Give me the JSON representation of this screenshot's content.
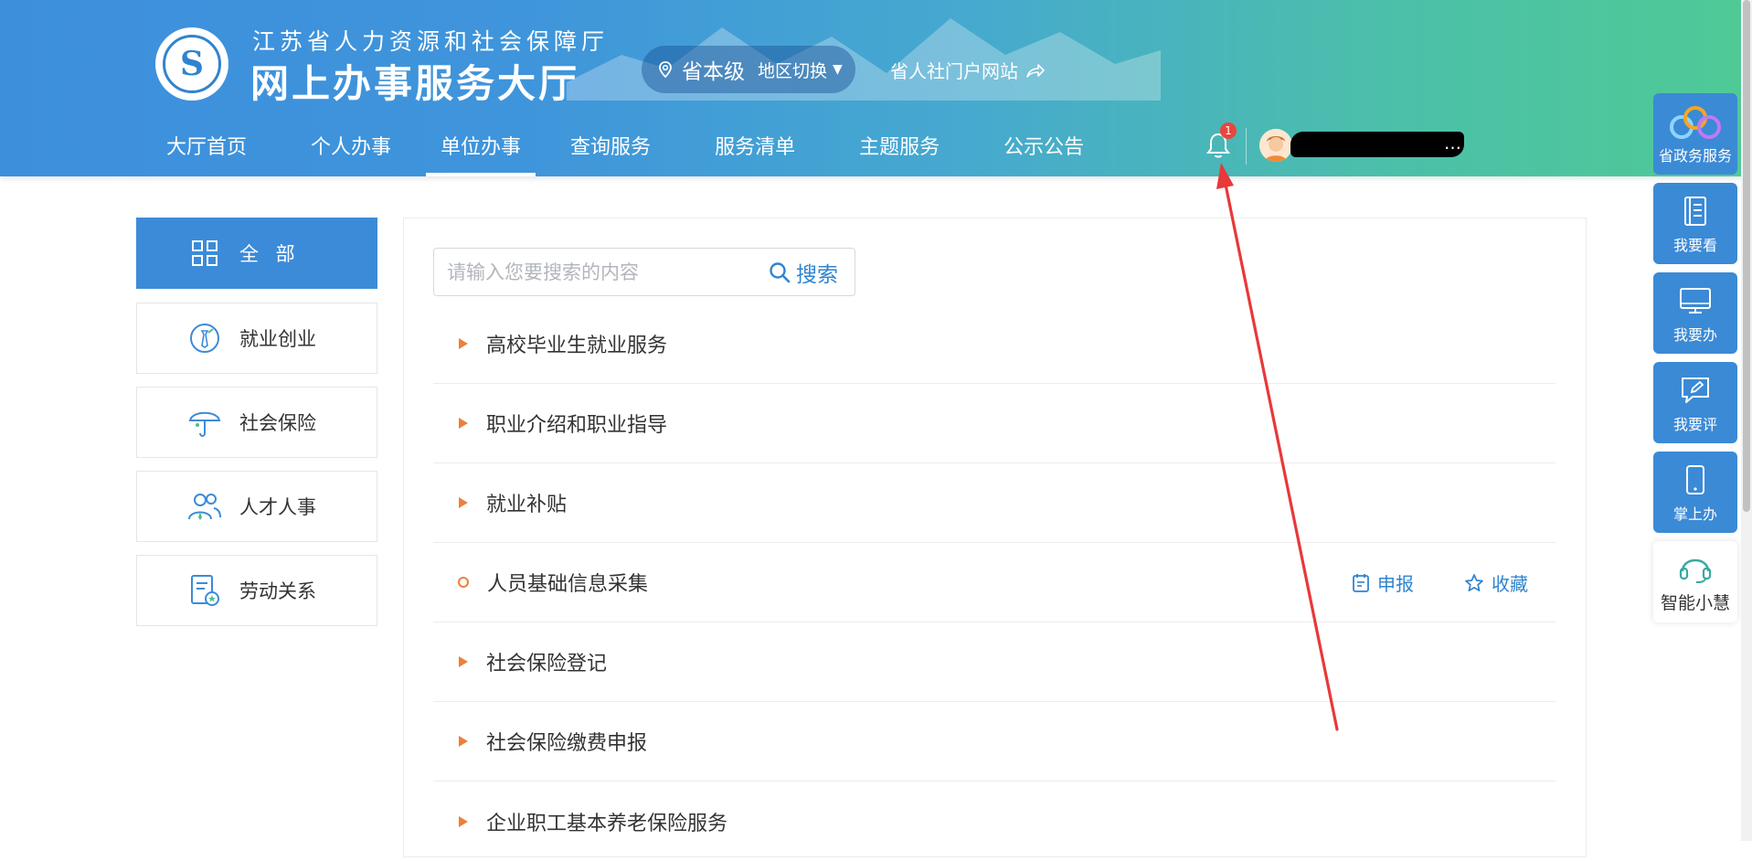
{
  "header": {
    "org_name": "江苏省人力资源和社会保障厅",
    "hall_name": "网上办事服务大厅",
    "region_level": "省本级",
    "region_switch": "地区切换",
    "portal_link": "省人社门户网站"
  },
  "nav": {
    "items": [
      {
        "label": "大厅首页"
      },
      {
        "label": "个人办事"
      },
      {
        "label": "单位办事",
        "active": true
      },
      {
        "label": "查询服务"
      },
      {
        "label": "服务清单"
      },
      {
        "label": "主题服务"
      },
      {
        "label": "公示公告"
      }
    ],
    "notification_count": "1",
    "user_name_suffix": "…"
  },
  "sidebar": {
    "items": [
      {
        "label": "全 部",
        "icon": "grid-icon",
        "active": true
      },
      {
        "label": "就业创业",
        "icon": "employment-icon"
      },
      {
        "label": "社会保险",
        "icon": "umbrella-icon"
      },
      {
        "label": "人才人事",
        "icon": "people-icon"
      },
      {
        "label": "劳动关系",
        "icon": "document-badge-icon"
      }
    ]
  },
  "search": {
    "placeholder": "请输入您要搜索的内容",
    "button_label": "搜索"
  },
  "services": [
    {
      "label": "高校毕业生就业服务"
    },
    {
      "label": "职业介绍和职业指导"
    },
    {
      "label": "就业补贴"
    },
    {
      "label": "人员基础信息采集",
      "expanded": true,
      "actions": [
        "申报",
        "收藏"
      ]
    },
    {
      "label": "社会保险登记"
    },
    {
      "label": "社会保险缴费申报"
    },
    {
      "label": "企业职工基本养老保险服务"
    }
  ],
  "float_bar": {
    "items": [
      {
        "label": "省政务服务",
        "icon": "gov-service-logo-icon"
      },
      {
        "label": "我要看",
        "icon": "notebook-icon"
      },
      {
        "label": "我要办",
        "icon": "monitor-icon"
      },
      {
        "label": "我要评",
        "icon": "edit-comment-icon"
      },
      {
        "label": "掌上办",
        "icon": "mobile-icon"
      },
      {
        "label": "智能小慧",
        "icon": "headset-icon"
      }
    ]
  },
  "colors": {
    "primary": "#3c8bd8",
    "accent_orange": "#ee7f3a",
    "annotation_red": "#e8383a"
  }
}
